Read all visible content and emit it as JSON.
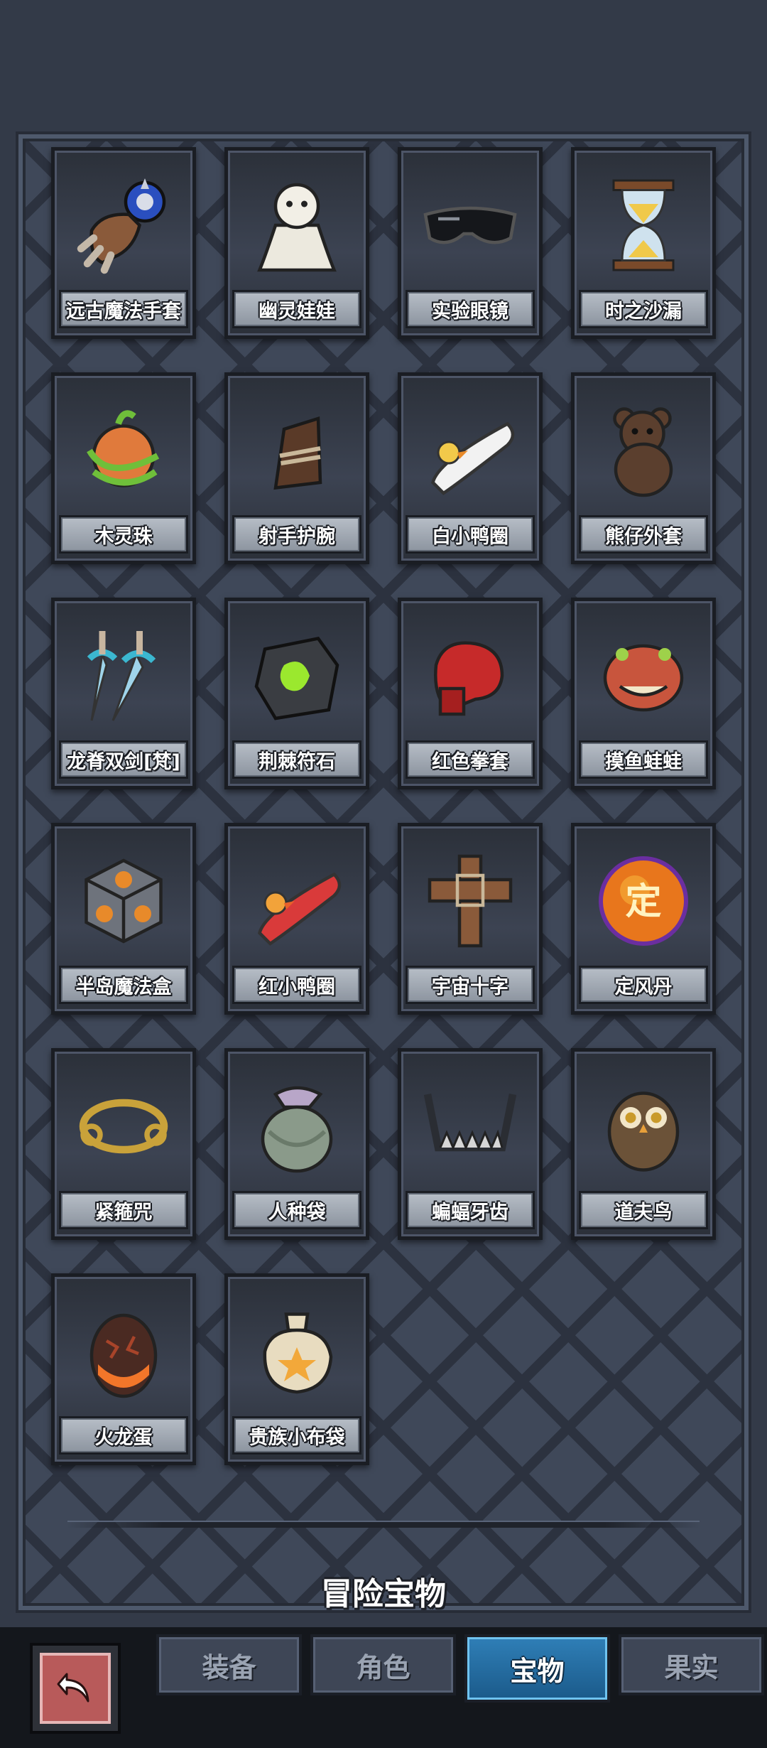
{
  "items": [
    {
      "name": "远古魔法手套",
      "icon": "gauntlet-icon"
    },
    {
      "name": "幽灵娃娃",
      "icon": "ghost-doll-icon"
    },
    {
      "name": "实验眼镜",
      "icon": "goggles-icon"
    },
    {
      "name": "时之沙漏",
      "icon": "hourglass-icon"
    },
    {
      "name": "木灵珠",
      "icon": "wood-orb-icon"
    },
    {
      "name": "射手护腕",
      "icon": "bracer-icon"
    },
    {
      "name": "白小鸭圈",
      "icon": "white-duck-ring-icon"
    },
    {
      "name": "熊仔外套",
      "icon": "teddy-bear-icon"
    },
    {
      "name": "龙脊双剑[梵]",
      "icon": "twin-swords-icon"
    },
    {
      "name": "荆棘符石",
      "icon": "rune-stone-icon"
    },
    {
      "name": "红色拳套",
      "icon": "boxing-glove-icon"
    },
    {
      "name": "摸鱼蛙蛙",
      "icon": "frog-icon"
    },
    {
      "name": "半岛魔法盒",
      "icon": "magic-cube-icon"
    },
    {
      "name": "红小鸭圈",
      "icon": "red-duck-ring-icon"
    },
    {
      "name": "宇宙十字",
      "icon": "cross-icon"
    },
    {
      "name": "定风丹",
      "icon": "fire-orb-icon",
      "glyph": "定"
    },
    {
      "name": "紧箍咒",
      "icon": "golden-circlet-icon"
    },
    {
      "name": "人种袋",
      "icon": "seed-bag-icon"
    },
    {
      "name": "蝙蝠牙齿",
      "icon": "bat-teeth-icon"
    },
    {
      "name": "道夫鸟",
      "icon": "owl-icon"
    },
    {
      "name": "火龙蛋",
      "icon": "dragon-egg-icon"
    },
    {
      "name": "贵族小布袋",
      "icon": "cloth-pouch-icon"
    }
  ],
  "footer": {
    "title": "冒险宝物"
  },
  "tabs": [
    {
      "label": "装备",
      "active": false
    },
    {
      "label": "角色",
      "active": false
    },
    {
      "label": "宝物",
      "active": true
    },
    {
      "label": "果实",
      "active": false
    }
  ],
  "back_button": {
    "icon": "back-arrow-icon"
  },
  "colors": {
    "active_tab": "#2f7fb7",
    "panel": "#3f4859"
  }
}
